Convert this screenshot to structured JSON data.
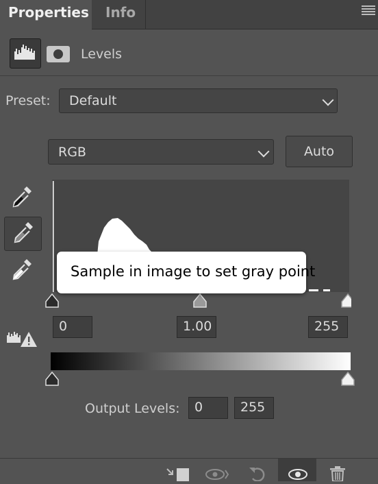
{
  "tabs": [
    {
      "label": "Properties",
      "active": true
    },
    {
      "label": "Info",
      "active": false
    }
  ],
  "header": {
    "title": "Levels",
    "panel_icon": "histogram-icon",
    "mask_icon": "layer-mask-icon"
  },
  "preset": {
    "label": "Preset:",
    "value": "Default"
  },
  "channel": {
    "value": "RGB",
    "auto_label": "Auto"
  },
  "eyedroppers": [
    {
      "name": "black-point-eyedropper",
      "selected": false
    },
    {
      "name": "gray-point-eyedropper",
      "selected": true
    },
    {
      "name": "white-point-eyedropper",
      "selected": false
    }
  ],
  "input_levels": {
    "black": "0",
    "gamma": "1.00",
    "white": "255"
  },
  "output_levels": {
    "label": "Output Levels:",
    "black": "0",
    "white": "255"
  },
  "tooltip": {
    "text": "Sample in image to set gray point"
  },
  "footer_icons": [
    "clip-to-layer-icon",
    "view-previous-state-icon",
    "reset-icon",
    "visibility-eye-icon",
    "delete-trash-icon"
  ],
  "colors": {
    "panel_bg": "#535353",
    "tabbar_bg": "#424242",
    "histogram_bg": "#454545"
  }
}
